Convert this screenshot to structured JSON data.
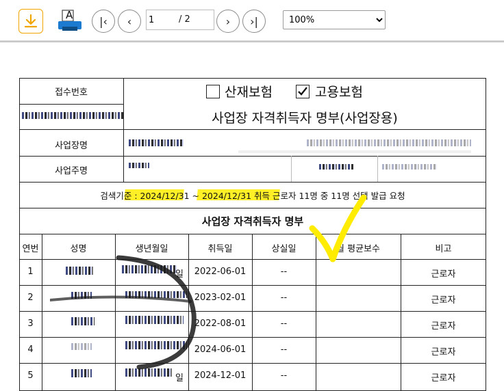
{
  "toolbar": {
    "download_icon": "download-icon",
    "print_icon": "print-icon",
    "print_letter": "A",
    "first_page": "|‹",
    "prev_page": "‹",
    "next_page": "›",
    "last_page": "›|",
    "current_page": "1",
    "total_pages": "/ 2",
    "zoom": "100%",
    "zoom_options": [
      "100%"
    ]
  },
  "document": {
    "receipt_label": "접수번호",
    "insurance_1": "산재보험",
    "insurance_2": "고용보험",
    "insurance_1_checked": false,
    "insurance_2_checked": true,
    "form_title": "사업장 자격취득자 명부(사업장용)",
    "business_name_label": "사업장명",
    "business_address_label": "사업주명",
    "search_criteria": "검색기준 : 2024/12/31 ~ 2024/12/31 취득 근로자 11명 중 11명 선택 발급 요청",
    "list_title": "사업장 자격취득자 명부",
    "columns": [
      "연번",
      "성명",
      "생년월일",
      "취득일",
      "상실일",
      "월 평균보수",
      "비고"
    ],
    "rows": [
      {
        "no": "1",
        "birth_suffix": "일",
        "acquired": "2022-06-01",
        "lost": "--",
        "salary": "",
        "note": "근로자"
      },
      {
        "no": "2",
        "birth_suffix": "",
        "acquired": "2023-02-01",
        "lost": "--",
        "salary": "",
        "note": "근로자"
      },
      {
        "no": "3",
        "birth_suffix": "",
        "acquired": "2022-08-01",
        "lost": "--",
        "salary": "",
        "note": "근로자"
      },
      {
        "no": "4",
        "birth_suffix": "",
        "acquired": "2024-06-01",
        "lost": "--",
        "salary": "",
        "note": "근로자"
      },
      {
        "no": "5",
        "birth_suffix": "일",
        "acquired": "2024-12-01",
        "lost": "--",
        "salary": "",
        "note": "근로자"
      }
    ]
  },
  "colors": {
    "accent": "#f0a500",
    "highlight": "#ffec00",
    "border": "#222222"
  }
}
